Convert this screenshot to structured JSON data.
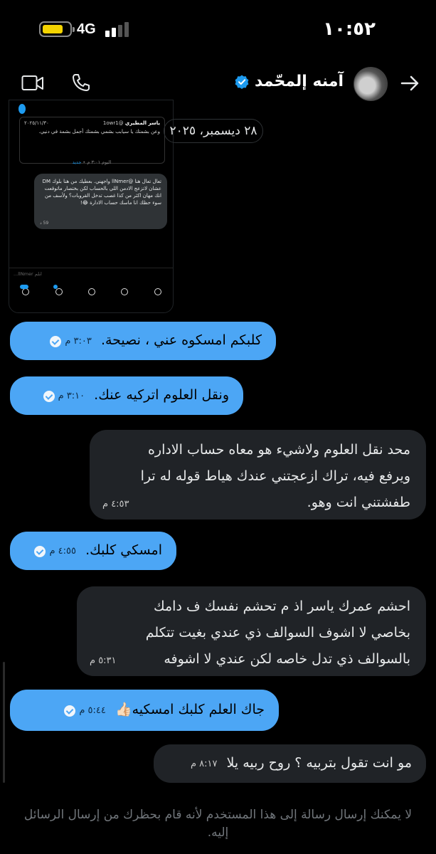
{
  "status_bar": {
    "network": "4G",
    "time": "١٠:٥٢"
  },
  "header": {
    "name": "آمنه إلمحّمد"
  },
  "date_separator": "٢٨ ديسمبر، ٢٠٢٥",
  "embedded": {
    "tweet_name": "ياسر المطيري",
    "tweet_handle": "@1owr1",
    "tweet_date": "٢٠٢٥/١١/٣٠",
    "tweet_text": "وعن بشمتك يا سيابب بشمي بشمتك أجمل بشمة في دنيي.",
    "today_label": "اليوم ٣:٠١ م",
    "new_label": "جديد",
    "message_text": "تعال تعال هنا @llNmer واجهني. بعطيك من هنا بلوك DM عشان لاتزعج الادمن اللي بالحساب لكن بختصار ماتوقعت انك مهان اكثر من كذا غصب تدخل القروبات؟ ولأسف من سوء حظك انا ماسك حساب الادارة 😂!",
    "message_time": "59 د",
    "input_placeholder": "ابلم llNmer..."
  },
  "messages": [
    {
      "text": "كلبكم امسكوه عني ، نصيحة.",
      "time": "٣:٠٣ م"
    },
    {
      "text": "ونقل العلوم اتركيه عنك.",
      "time": "٣:١٠ م"
    },
    {
      "text": "محد نقل العلوم ولاشيء هو معاه حساب الاداره\nويرفع فيه، تراك ازعجتني عندك هياط قوله له ترا\nطفشتني انت وهو.",
      "time": "٤:٥٣ م"
    },
    {
      "text": "امسكي كلبك.",
      "time": "٤:٥٥ م"
    },
    {
      "text": "احشم عمرك ياسر اذ م تحشم نفسك ف دامك\nبخاصي لا اشوف السوالف ذي عندي بغيت تتكلم\nبالسوالف ذي تدل خاصه لكن عندي لا اشوفه",
      "time": "٥:٣١ م"
    },
    {
      "text": "جاك العلم كلبك امسكيه👍🏻",
      "time": "٥:٤٤ م"
    },
    {
      "text": "مو انت تقول بتربيه ؟ روح ربيه يلا",
      "time": "٨:١٧ م"
    }
  ],
  "blocked_notice": "لا يمكنك إرسال رسالة إلى هذا المستخدم لأنه قام بحظرك من إرسال الرسائل إليه.",
  "colors": {
    "accent": "#4ca6f5",
    "bubble_gray": "#202327",
    "background": "#000000"
  }
}
